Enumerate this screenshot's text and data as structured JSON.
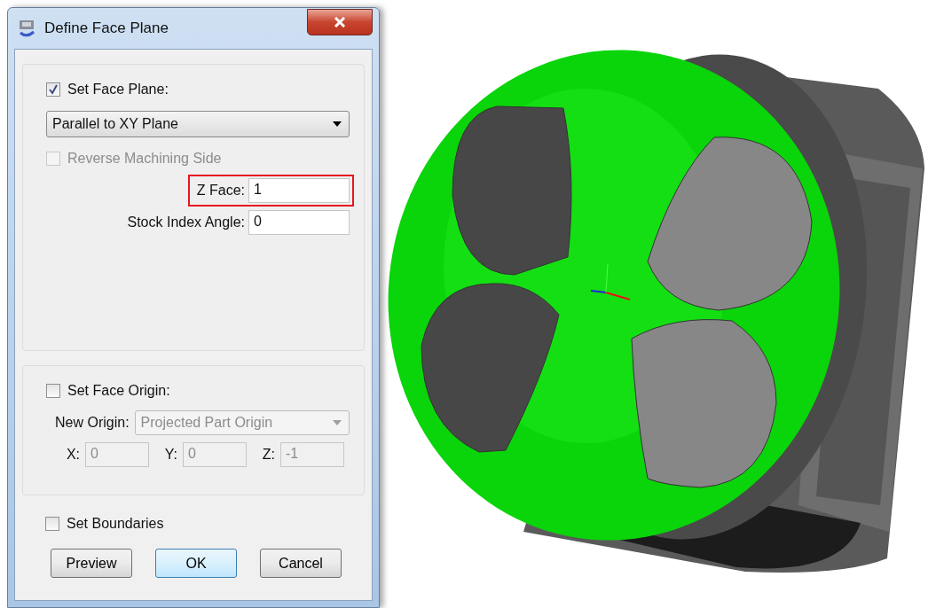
{
  "window": {
    "title": "Define Face Plane"
  },
  "face_plane": {
    "set_face_plane": {
      "label": "Set Face Plane:",
      "checked": true
    },
    "plane": {
      "value": "Parallel to XY Plane"
    },
    "reverse_side": {
      "label": "Reverse Machining Side",
      "checked": false,
      "disabled": true
    },
    "z_face": {
      "label": "Z Face:",
      "value": "1",
      "highlighted": true
    },
    "stock_index_angle": {
      "label": "Stock Index Angle:",
      "value": "0"
    }
  },
  "face_origin": {
    "set_face_origin": {
      "label": "Set Face Origin:",
      "checked": false
    },
    "new_origin": {
      "label": "New Origin:",
      "value": "Projected Part Origin",
      "disabled": true
    },
    "coords": [
      {
        "label": "X:",
        "value": "0",
        "disabled": true
      },
      {
        "label": "Y:",
        "value": "0",
        "disabled": true
      },
      {
        "label": "Z:",
        "value": "-1",
        "disabled": true
      }
    ]
  },
  "set_boundaries": {
    "label": "Set Boundaries",
    "checked": false
  },
  "buttons": [
    {
      "label": "Preview",
      "default": false
    },
    {
      "label": "OK",
      "default": true
    },
    {
      "label": "Cancel",
      "default": false
    }
  ]
}
